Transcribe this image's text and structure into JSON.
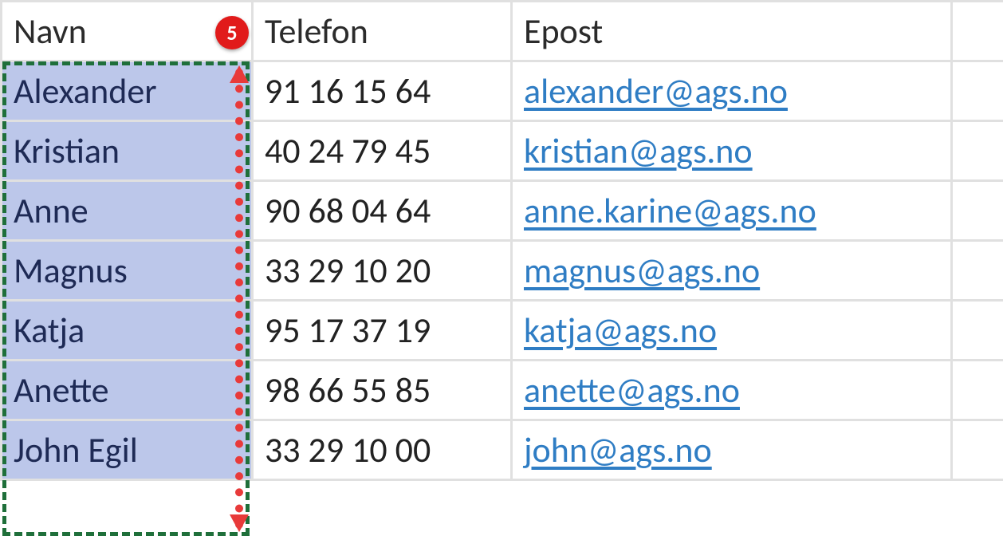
{
  "annotation": {
    "step_badge": "5"
  },
  "table": {
    "headers": {
      "name": "Navn",
      "phone": "Telefon",
      "email": "Epost"
    },
    "rows": [
      {
        "name": "Alexander",
        "phone": "91 16 15 64",
        "email": "alexander@ags.no"
      },
      {
        "name": "Kristian",
        "phone": "40 24 79 45",
        "email": "kristian@ags.no"
      },
      {
        "name": "Anne",
        "phone": "90 68 04 64",
        "email": "anne.karine@ags.no"
      },
      {
        "name": "Magnus",
        "phone": "33 29 10 20",
        "email": "magnus@ags.no"
      },
      {
        "name": "Katja",
        "phone": "95 17 37 19",
        "email": "katja@ags.no"
      },
      {
        "name": "Anette",
        "phone": "98 66 55 85",
        "email": "anette@ags.no"
      },
      {
        "name": "John Egil",
        "phone": "33 29 10 00",
        "email": "john@ags.no"
      }
    ]
  }
}
